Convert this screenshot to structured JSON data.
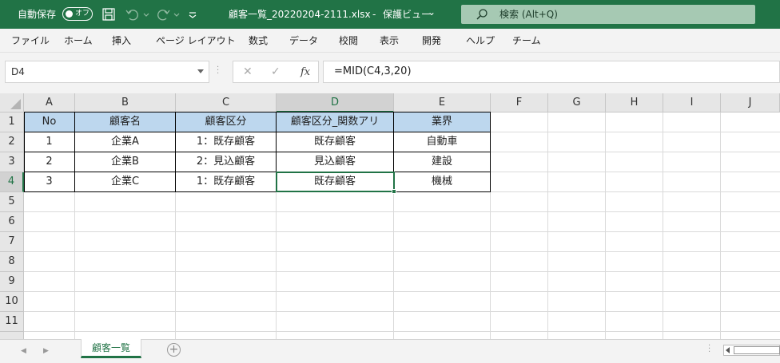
{
  "titlebar": {
    "autosave_label": "自動保存",
    "autosave_state": "オフ",
    "quick_access": [
      "save-icon",
      "undo-icon",
      "redo-icon",
      "customize-icon"
    ],
    "document_title": "顧客一覧_20220204-2111.xlsx",
    "separator": "-",
    "view_mode": "保護ビュー",
    "view_mode_chevron": "⌄",
    "search_placeholder": "検索 (Alt+Q)",
    "color": "#217346"
  },
  "ribbon": {
    "tabs": [
      "ファイル",
      "ホーム",
      "挿入",
      "ページ レイアウト",
      "数式",
      "データ",
      "校閲",
      "表示",
      "開発",
      "ヘルプ",
      "チーム"
    ]
  },
  "formula_bar": {
    "name_box": "D4",
    "cancel": "✕",
    "enter": "✓",
    "fx": "fx",
    "formula": "=MID(C4,3,20)"
  },
  "sheet": {
    "columns": [
      "A",
      "B",
      "C",
      "D",
      "E",
      "F",
      "G",
      "H",
      "I",
      "J"
    ],
    "rows": [
      "1",
      "2",
      "3",
      "4",
      "5",
      "6",
      "7",
      "8",
      "9",
      "10",
      "11"
    ],
    "selected_cell": "D4",
    "table": {
      "header": [
        "No",
        "顧客名",
        "顧客区分",
        "顧客区分_関数アリ",
        "業界"
      ],
      "header_fill": "#bdd7ee",
      "rows": [
        [
          "1",
          "企業A",
          "1：既存顧客",
          "既存顧客",
          "自動車"
        ],
        [
          "2",
          "企業B",
          "2：見込顧客",
          "見込顧客",
          "建設"
        ],
        [
          "3",
          "企業C",
          "1：既存顧客",
          "既存顧客",
          "機械"
        ]
      ]
    }
  },
  "sheet_tabs": {
    "prev": "◀",
    "next": "▶",
    "tabs": [
      "顧客一覧"
    ],
    "add": "+"
  }
}
